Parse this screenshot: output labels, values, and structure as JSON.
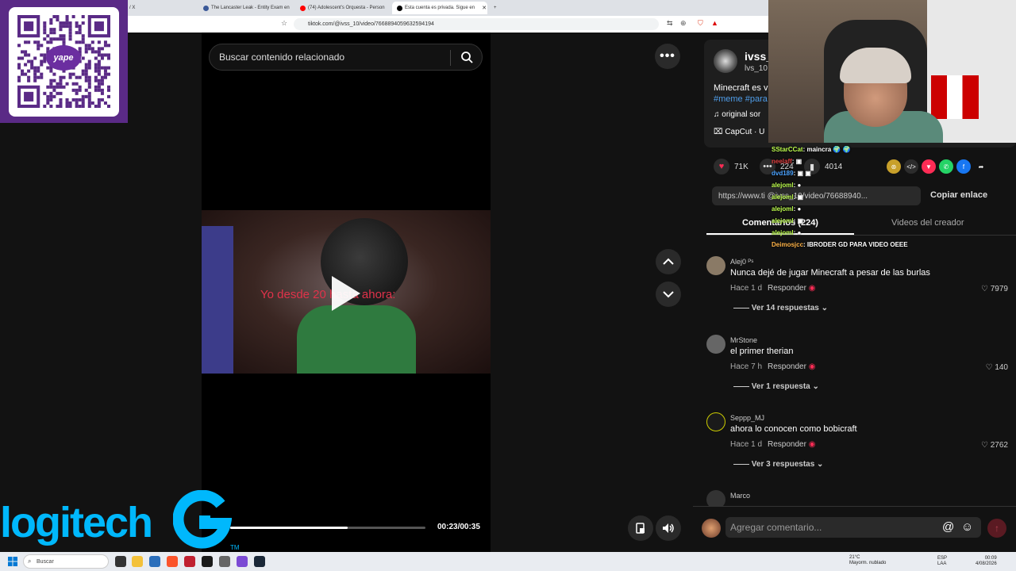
{
  "browser": {
    "tabs": [
      {
        "label": "u / X",
        "favicon_color": "#888888"
      },
      {
        "label": "The Lancaster Leak - Entity Exam en",
        "favicon_color": "#3b5998"
      },
      {
        "label": "(74) Adolescent's Orquesta - Person",
        "favicon_color": "#ff0000"
      },
      {
        "label": "Esta cuenta es privada. Sigue en",
        "favicon_color": "#000000"
      }
    ],
    "new_tab_symbol": "+",
    "url": "tiktok.com/@ivss_10/video/7668894059632594194"
  },
  "video_page": {
    "search_placeholder": "Buscar contenido relacionado",
    "more_label": "•••",
    "video_caption": "Yo desde 20   hasta ahora:",
    "time": "00:23/00:35",
    "progress_fraction": 0.6
  },
  "overlay": {
    "qr_badge": "yape",
    "sponsor_logo": "logitech",
    "sponsor_mark": "TM"
  },
  "author": {
    "name": "ivss_",
    "handle": "lvs_10",
    "description": "Minecraft es v",
    "tags": "#meme #para",
    "music": "original sor",
    "capcut": "CapCut · U"
  },
  "stats": {
    "likes": "71K",
    "comments": "224",
    "saves": "4014",
    "like_color": "#fe2c55"
  },
  "share": {
    "link": "https://www.ti        @ivss_10/video/76688940...",
    "copy_label": "Copiar enlace",
    "icons": [
      {
        "name": "embed-icon",
        "symbol": "</>",
        "color": "#2c2c2c"
      },
      {
        "name": "send-icon",
        "symbol": "▼",
        "color": "#fe2c55"
      },
      {
        "name": "whatsapp-icon",
        "symbol": "✆",
        "color": "#25d366"
      },
      {
        "name": "facebook-icon",
        "symbol": "f",
        "color": "#1877f2"
      },
      {
        "name": "forward-icon",
        "symbol": "➦",
        "color": "#121212"
      }
    ]
  },
  "tabs": {
    "comments": "Comentarios (224)",
    "creator_videos": "Videos del creador"
  },
  "comments": [
    {
      "user": "Alej0 ᴾˢ",
      "text": "Nunca dejé de jugar Minecraft a pesar de las burlas",
      "time": "Hace 1 d",
      "reply": "Responder",
      "likes": "7979",
      "replies": "Ver 14 respuestas ⌄"
    },
    {
      "user": "MrStone",
      "text": "el primer therian",
      "time": "Hace 7 h",
      "reply": "Responder",
      "likes": "140",
      "replies": "Ver 1 respuesta ⌄"
    },
    {
      "user": "Seppp_MJ",
      "text": "ahora lo conocen como bobicraft",
      "time": "Hace 1 d",
      "reply": "Responder",
      "likes": "2762",
      "replies": "Ver 3 respuestas ⌄"
    },
    {
      "user": "Marco",
      "text": "",
      "time": "",
      "reply": "",
      "likes": "",
      "replies": ""
    }
  ],
  "comment_box": {
    "placeholder": "Agregar comentario...",
    "at": "@",
    "emoji": "☺",
    "send": "↑"
  },
  "chat": [
    {
      "user": "SStarCCat",
      "msg": ": maincra 🌍 🌍"
    },
    {
      "user": "neelaff",
      "msg": ":  ▣"
    },
    {
      "user": "dvd189",
      "msg": ":  ▣ ▣"
    },
    {
      "user": "alejoml",
      "msg": ": ●"
    },
    {
      "user": "alejoml",
      "msg": ": ▣"
    },
    {
      "user": "alejoml",
      "msg": ": ●"
    },
    {
      "user": "alejoml",
      "msg": ": ▣"
    },
    {
      "user": "alejoml",
      "msg": ": ●"
    },
    {
      "user": "Deimosjcc",
      "msg": ": IBRODER GD PARA VIDEO OEEE"
    }
  ],
  "taskbar": {
    "search": "Buscar",
    "weather": "21°C\nMayorm. nublado",
    "lang": "ESP\nLAA",
    "time": "00:09",
    "date": "4/08/2026"
  }
}
